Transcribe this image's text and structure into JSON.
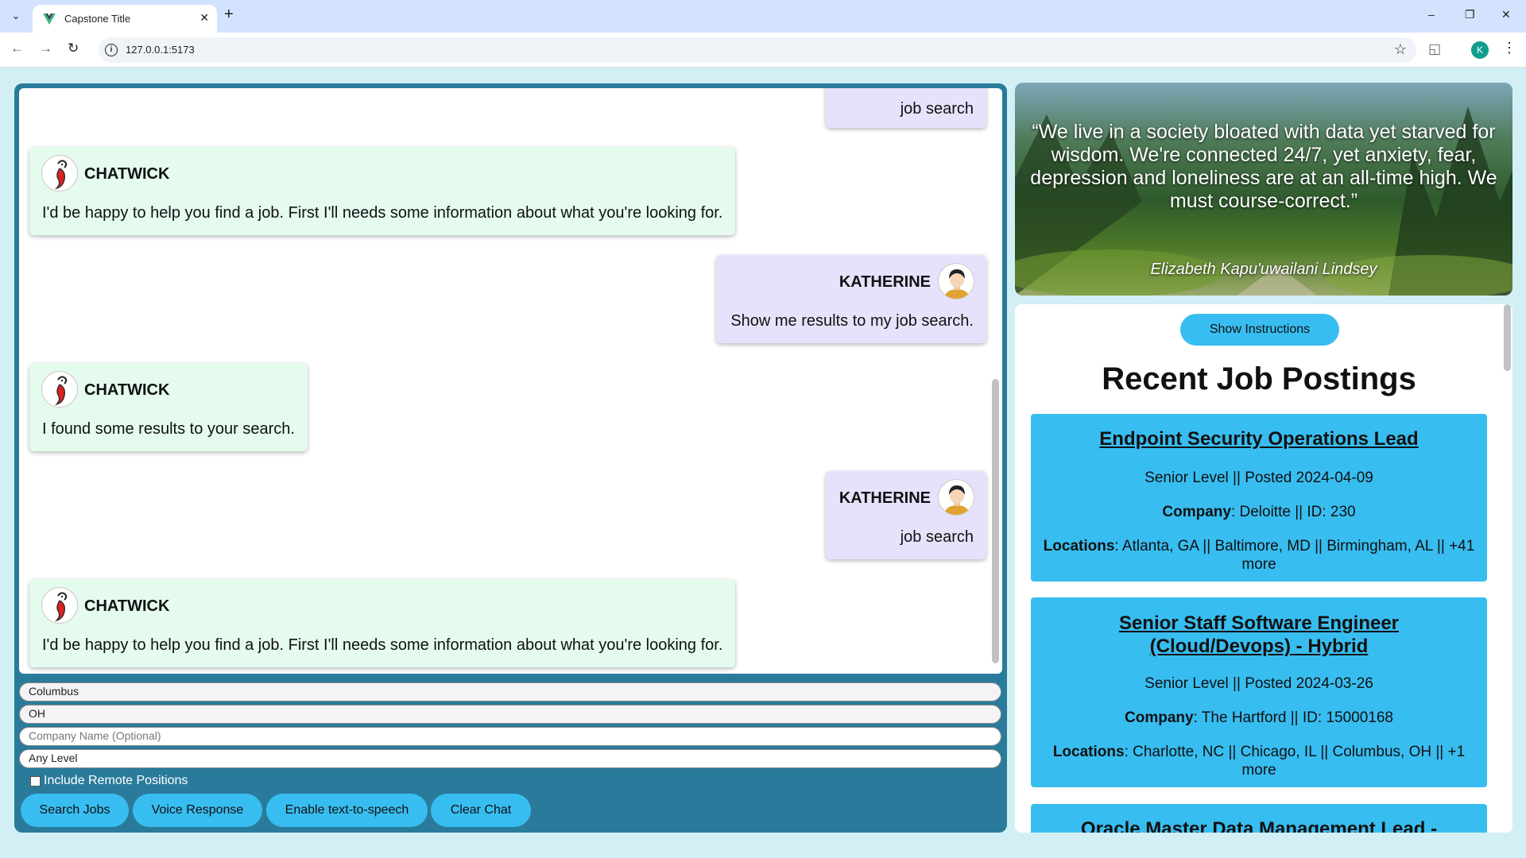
{
  "browser": {
    "tab_title": "Capstone Title",
    "url": "127.0.0.1:5173",
    "profile_initial": "K"
  },
  "chat": {
    "messages": [
      {
        "sender": "",
        "text": "job search",
        "role": "user"
      },
      {
        "sender": "CHATWICK",
        "text": "I'd be happy to help you find a job. First I'll needs some information about what you're looking for.",
        "role": "bot"
      },
      {
        "sender": "KATHERINE",
        "text": "Show me results to my job search.",
        "role": "user"
      },
      {
        "sender": "CHATWICK",
        "text": "I found some results to your search.",
        "role": "bot"
      },
      {
        "sender": "KATHERINE",
        "text": "job search",
        "role": "user"
      },
      {
        "sender": "CHATWICK",
        "text": "I'd be happy to help you find a job. First I'll needs some information about what you're looking for.",
        "role": "bot"
      }
    ]
  },
  "form": {
    "city": "Columbus",
    "state": "OH",
    "company_placeholder": "Company Name (Optional)",
    "level": "Any Level",
    "remote_label": "Include Remote Positions",
    "remote_checked": false
  },
  "buttons": {
    "search": "Search Jobs",
    "voice": "Voice Response",
    "tts": "Enable text-to-speech",
    "clear": "Clear Chat"
  },
  "quote": {
    "text": "“We live in a society bloated with data yet starved for wisdom. We're connected 24/7, yet anxiety, fear, depression and loneliness are at an all-time high. We must course-correct.”",
    "author": "Elizabeth Kapu'uwailani Lindsey"
  },
  "postings": {
    "instructions_button": "Show Instructions",
    "heading": "Recent Job Postings",
    "company_label": "Company",
    "locations_label": "Locations",
    "jobs": [
      {
        "title": "Endpoint Security Operations Lead",
        "meta": "Senior Level || Posted 2024-04-09",
        "company": ": Deloitte || ID: 230",
        "locations": ": Atlanta, GA || Baltimore, MD || Birmingham, AL || +41 more"
      },
      {
        "title": "Senior Staff Software Engineer (Cloud/Devops) - Hybrid",
        "meta": "Senior Level || Posted 2024-03-26",
        "company": ": The Hartford || ID: 15000168",
        "locations": ": Charlotte, NC || Chicago, IL || Columbus, OH || +1 more"
      },
      {
        "title": "Oracle Master Data Management Lead -"
      }
    ]
  },
  "colors": {
    "page_bg": "#d3eff6",
    "chat_panel": "#2a7b9b",
    "bot_bubble": "#e4fbee",
    "user_bubble": "#e8e1fb",
    "accent_button": "#38bdf0",
    "job_card": "#38bdf0"
  }
}
